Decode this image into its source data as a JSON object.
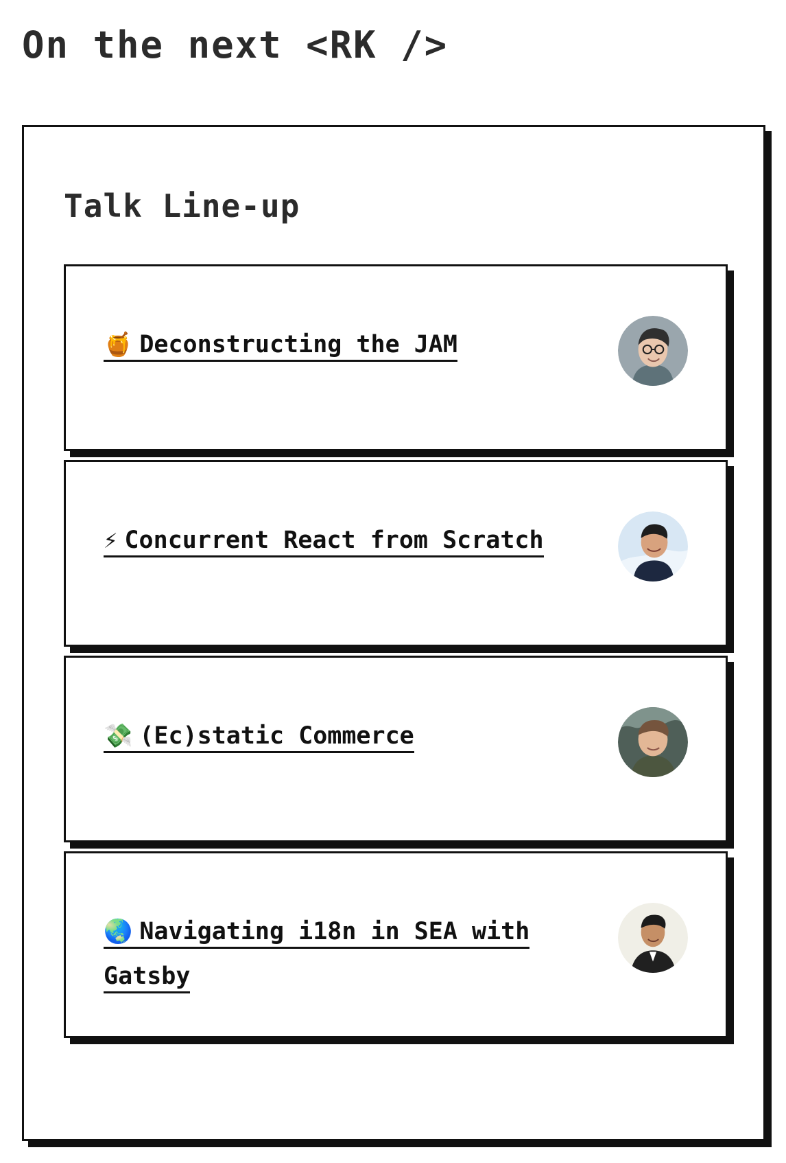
{
  "header": {
    "title": "On the next <RK />"
  },
  "lineup": {
    "title": "Talk Line-up",
    "talks": [
      {
        "emoji": "🍯",
        "icon": "honey-pot-icon",
        "title": "Deconstructing the JAM",
        "avatar_colors": {
          "bg": "#9aa6ad",
          "skin": "#e9c7ae",
          "hair": "#2f2f2f",
          "shirt": "#5e7279"
        }
      },
      {
        "emoji": "⚡",
        "icon": "lightning-icon",
        "title": "Concurrent React from Scratch",
        "avatar_colors": {
          "bg": "#d8e7f4",
          "skin": "#d8a27e",
          "hair": "#1d1d1d",
          "shirt": "#1d2840"
        }
      },
      {
        "emoji": "💸",
        "icon": "money-with-wings-icon",
        "title": "(Ec)static Commerce",
        "avatar_colors": {
          "bg": "#4f5f58",
          "skin": "#e3b796",
          "hair": "#75543d",
          "shirt": "#4c563f"
        }
      },
      {
        "emoji": "🌏",
        "icon": "globe-asia-australia-icon",
        "title": "Navigating i18n in SEA with Gatsby",
        "avatar_colors": {
          "bg": "#f0efe7",
          "skin": "#c58f66",
          "hair": "#1b1b1b",
          "shirt": "#202020"
        }
      }
    ]
  }
}
